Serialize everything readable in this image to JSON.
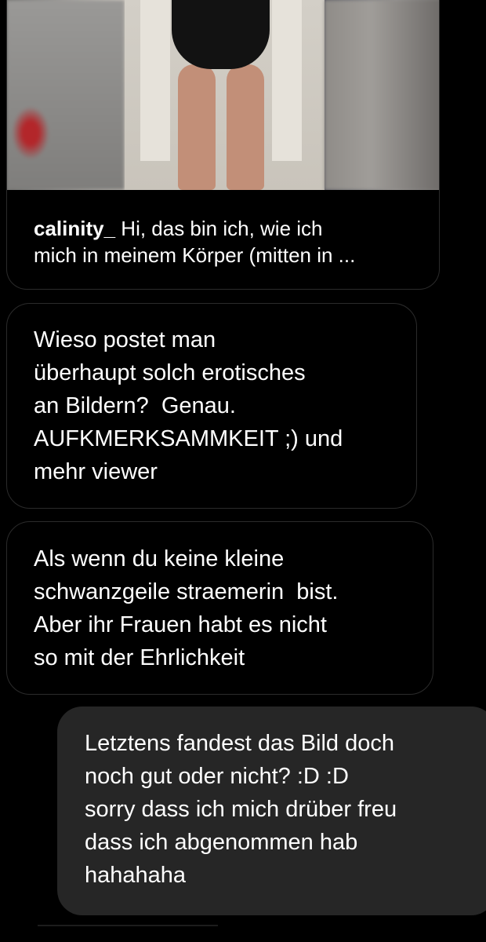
{
  "shared_post": {
    "username": "calinity_",
    "caption_line1": " Hi, das bin ich, wie ich",
    "caption_line2": "mich in meinem Körper (mitten in ..."
  },
  "messages": [
    {
      "direction": "received",
      "lines": [
        "Wieso postet man",
        "überhaupt solch erotisches",
        "an Bildern?  Genau.",
        "AUFKMERKSAMMKEIT ;) und",
        "mehr viewer"
      ]
    },
    {
      "direction": "received",
      "lines": [
        "Als wenn du keine kleine",
        "schwanzgeile straemerin  bist.",
        "Aber ihr Frauen habt es nicht",
        "so mit der Ehrlichkeit"
      ]
    },
    {
      "direction": "sent",
      "lines": [
        "Letztens fandest das Bild doch",
        "noch gut oder nicht? :D :D",
        "sorry dass ich mich drüber freu",
        "dass ich abgenommen hab",
        "hahahaha"
      ]
    }
  ],
  "colors": {
    "background": "#000000",
    "received_border": "#2b2b2b",
    "sent_bubble": "#262626",
    "text": "#ffffff"
  }
}
